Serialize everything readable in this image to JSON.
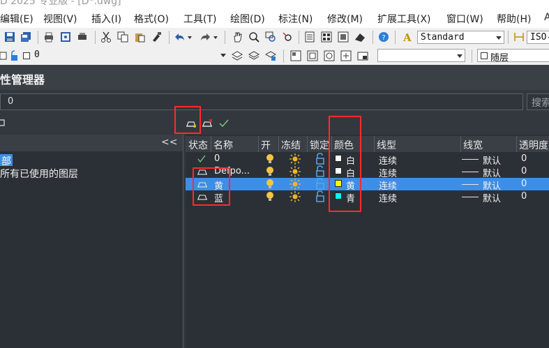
{
  "title_fragment": "D 2025 专业版 - [D*.dwg]",
  "menu": [
    "编辑(E)",
    "视图(V)",
    "插入(I)",
    "格式(O)",
    "工具(T)",
    "绘图(D)",
    "标注(N)",
    "修改(M)",
    "扩展工具(X)",
    "窗口(W)",
    "帮助(H)",
    "A"
  ],
  "toolbar": {
    "text_style": "Standard",
    "dim_style": "ISO-",
    "layer_combo": "0",
    "color_combo": "随层"
  },
  "panel": {
    "title": "性管理器",
    "current_layer": "0",
    "search_placeholder": "搜索"
  },
  "filter_tree": {
    "collapse_label": "<<",
    "items": [
      "部",
      "所有已使用的图层"
    ]
  },
  "columns": [
    "状态",
    "名称",
    "开",
    "冻结",
    "锁定",
    "颜色",
    "线型",
    "线宽",
    "透明度"
  ],
  "layers": [
    {
      "status": "current",
      "name": "0",
      "color_name": "白",
      "color_hex": "#ffffff",
      "linetype": "连续",
      "lineweight": "默认",
      "transparency": "0",
      "selected": false
    },
    {
      "status": "layer",
      "name": "Defpo...",
      "color_name": "白",
      "color_hex": "#ffffff",
      "linetype": "连续",
      "lineweight": "默认",
      "transparency": "0",
      "selected": false
    },
    {
      "status": "layer",
      "name": "黄",
      "color_name": "黄",
      "color_hex": "#ffff00",
      "linetype": "连续",
      "lineweight": "默认",
      "transparency": "0",
      "selected": true
    },
    {
      "status": "layer",
      "name": "蓝",
      "color_name": "青",
      "color_hex": "#00ffff",
      "linetype": "连续",
      "lineweight": "默认",
      "transparency": "0",
      "selected": false
    }
  ],
  "colors": {
    "selection": "#3d8ee6",
    "highlight_box": "#ff2a2a",
    "bulb": "#f5c542",
    "sun": "#f0b429",
    "lock": "#58a6e6"
  }
}
